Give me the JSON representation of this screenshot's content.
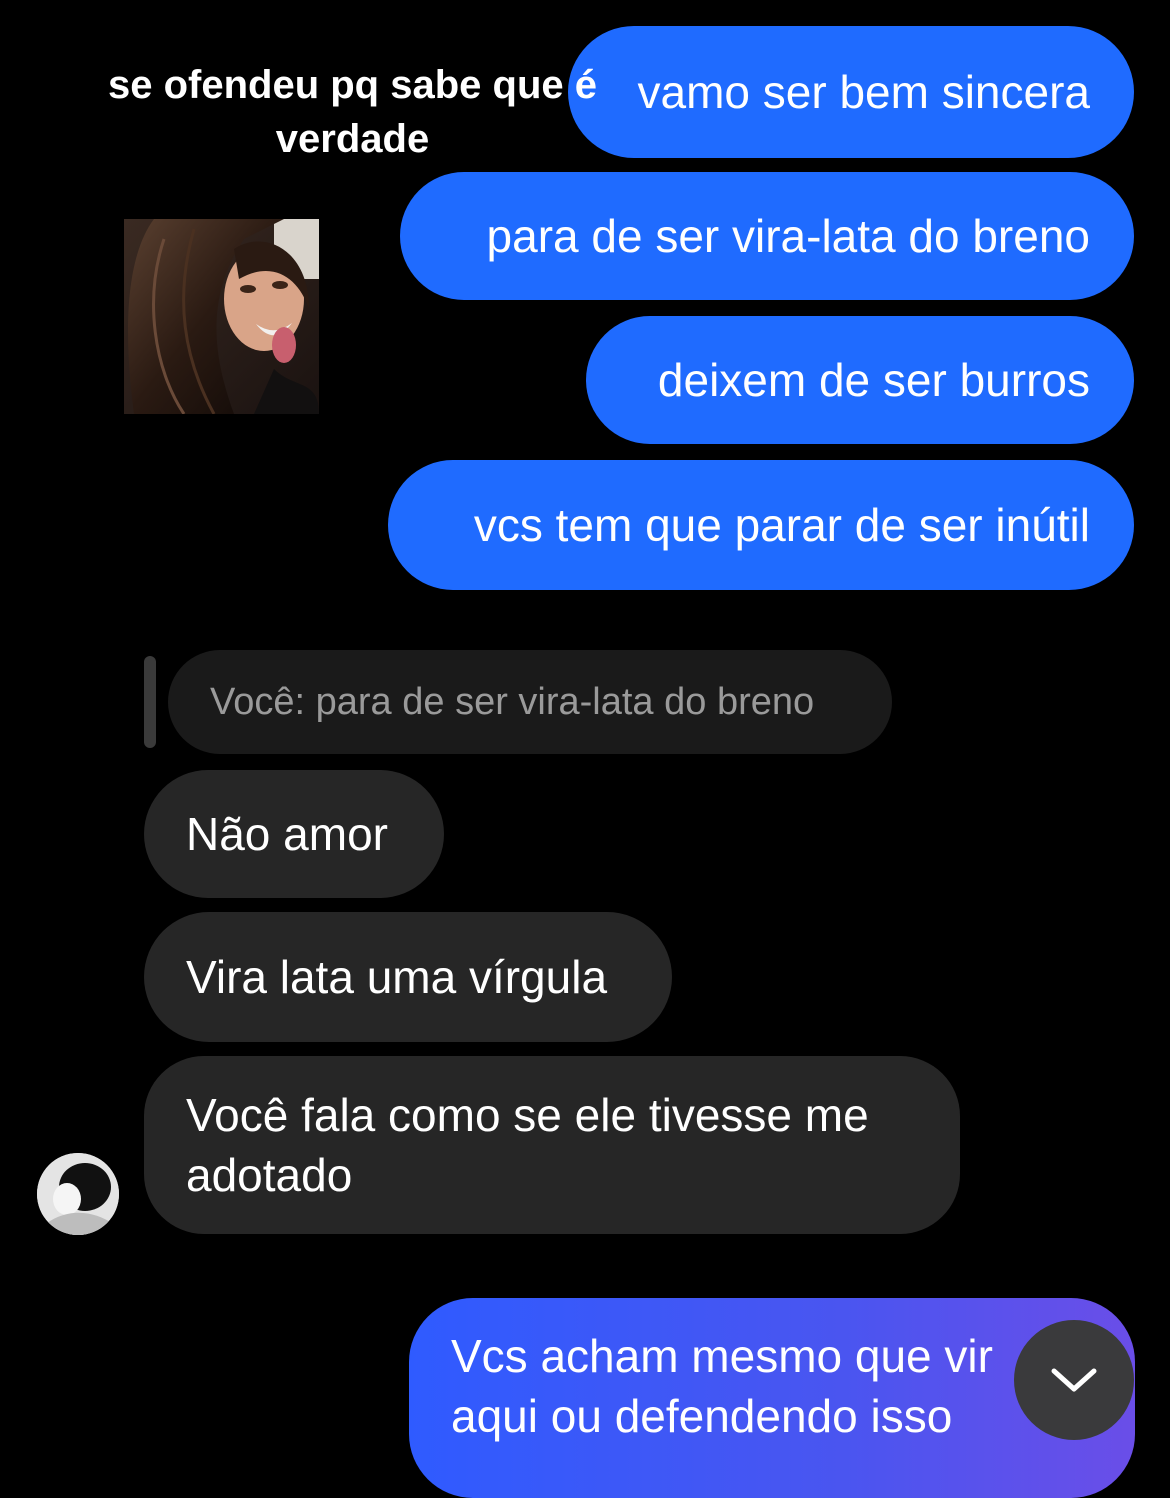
{
  "overlay": {
    "caption": "se ofendeu pq sabe que é verdade"
  },
  "messages": {
    "sent": [
      "vamo ser bem sincera",
      "para de ser vira-lata do breno",
      "deixem de ser burros",
      "vcs tem que parar de ser inútil"
    ],
    "reply_quote": "Você: para de ser vira-lata do breno",
    "received": [
      "Não amor",
      "Vira lata uma vírgula",
      "Você fala como se ele tivesse me adotado"
    ],
    "last_sent": "Vcs acham mesmo que vir aqui ou defendendo isso"
  },
  "colors": {
    "background": "#000000",
    "sent_bubble": "#1f6bff",
    "received_bubble": "#262626",
    "quote_bubble": "#1a1a1a",
    "quote_text": "#9a9a9a"
  },
  "icons": {
    "scroll_down": "chevron-down-icon"
  }
}
